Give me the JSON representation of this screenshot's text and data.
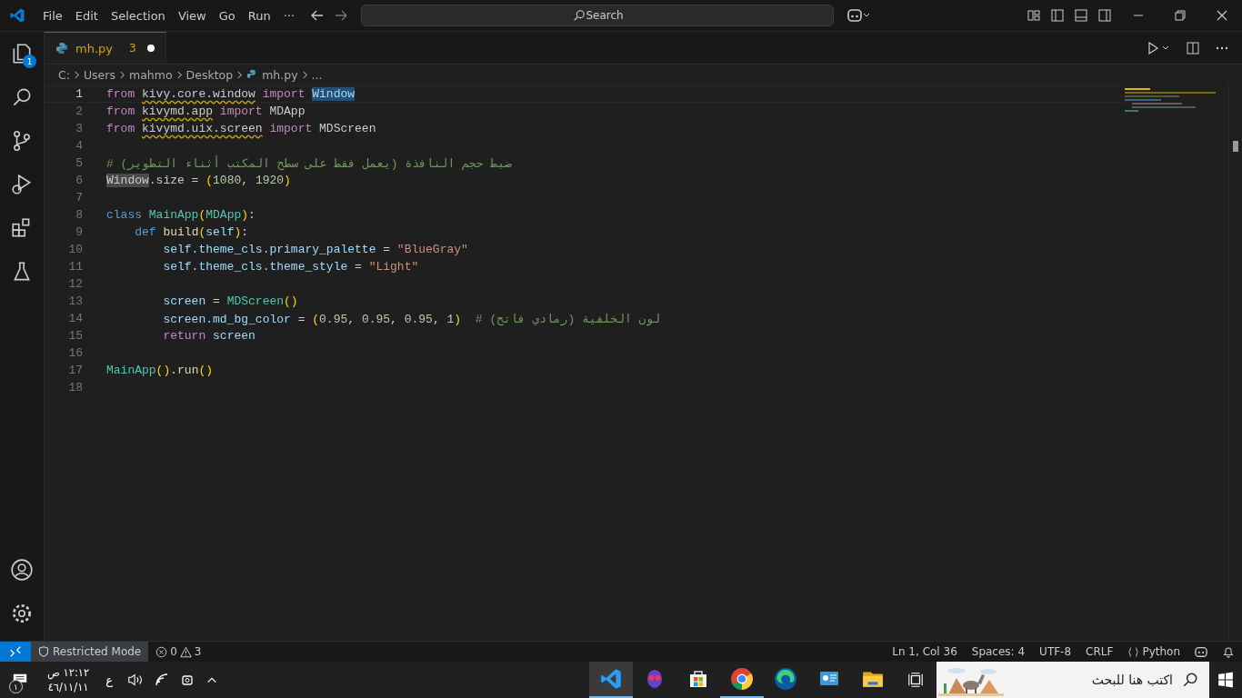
{
  "window": {
    "menu": [
      "File",
      "Edit",
      "Selection",
      "View",
      "Go",
      "Run",
      "···"
    ],
    "search": {
      "placeholder": "Search"
    }
  },
  "activity_bar": [
    {
      "kind": "explorer",
      "badge": "1"
    },
    {
      "kind": "search"
    },
    {
      "kind": "source-control"
    },
    {
      "kind": "run-debug"
    },
    {
      "kind": "extensions"
    },
    {
      "kind": "testing"
    }
  ],
  "tabs": [
    {
      "label": "mh.py",
      "problems": "3",
      "modified": true,
      "selected": true
    }
  ],
  "breadcrumbs": [
    {
      "kind": "folder",
      "text": "C:"
    },
    {
      "kind": "folder",
      "text": "Users"
    },
    {
      "kind": "folder",
      "text": "mahmo"
    },
    {
      "kind": "folder",
      "text": "Desktop"
    },
    {
      "kind": "python",
      "text": "mh.py"
    },
    {
      "kind": "symbol",
      "text": "..."
    }
  ],
  "editor": {
    "lines": [
      {
        "number": "1",
        "current": true,
        "tokens": [
          {
            "kind": "kw",
            "text": "from "
          },
          {
            "kind": "mod",
            "text": "kivy.core.window"
          },
          {
            "kind": "kw",
            "text": " import "
          },
          {
            "kind": "sel",
            "text": "Window"
          }
        ]
      },
      {
        "number": "2",
        "current": false,
        "tokens": [
          {
            "kind": "kw",
            "text": "from "
          },
          {
            "kind": "mod",
            "text": "kivymd.app"
          },
          {
            "kind": "kw",
            "text": " import "
          },
          {
            "kind": "plain",
            "text": "MDApp"
          }
        ]
      },
      {
        "number": "3",
        "current": false,
        "tokens": [
          {
            "kind": "kw",
            "text": "from "
          },
          {
            "kind": "mod",
            "text": "kivymd.uix.screen"
          },
          {
            "kind": "kw",
            "text": " import "
          },
          {
            "kind": "plain",
            "text": "MDScreen"
          }
        ]
      },
      {
        "number": "4",
        "current": false
      },
      {
        "number": "5",
        "current": false,
        "tokens": [
          {
            "kind": "comment",
            "text": "# ضبط حجم النافذة (يعمل فقط على سطح المكتب أثناء التطوير)"
          }
        ]
      },
      {
        "number": "6",
        "current": false,
        "tokens": [
          {
            "kind": "hl",
            "text": "Window"
          },
          {
            "kind": "plain",
            "text": ".size = "
          },
          {
            "kind": "paren",
            "text": "("
          },
          {
            "kind": "num",
            "text": "1080"
          },
          {
            "kind": "plain",
            "text": ", "
          },
          {
            "kind": "num",
            "text": "1920"
          },
          {
            "kind": "paren",
            "text": ")"
          }
        ]
      },
      {
        "number": "7",
        "current": false
      },
      {
        "number": "8",
        "current": false,
        "tokens": [
          {
            "kind": "def",
            "text": "class "
          },
          {
            "kind": "cls",
            "text": "MainApp"
          },
          {
            "kind": "paren",
            "text": "("
          },
          {
            "kind": "cls",
            "text": "MDApp"
          },
          {
            "kind": "paren",
            "text": ")"
          },
          {
            "kind": "plain",
            "text": ":"
          }
        ]
      },
      {
        "number": "9",
        "current": false,
        "tokens": [
          {
            "kind": "def",
            "text": "    def "
          },
          {
            "kind": "fn",
            "text": "build"
          },
          {
            "kind": "paren",
            "text": "("
          },
          {
            "kind": "var",
            "text": "self"
          },
          {
            "kind": "paren",
            "text": ")"
          },
          {
            "kind": "plain",
            "text": ":"
          }
        ]
      },
      {
        "number": "10",
        "current": false,
        "tokens": [
          {
            "kind": "var",
            "text": "        self.theme_cls.primary_palette"
          },
          {
            "kind": "plain",
            "text": " = "
          },
          {
            "kind": "str",
            "text": "\"BlueGray\""
          }
        ]
      },
      {
        "number": "11",
        "current": false,
        "tokens": [
          {
            "kind": "var",
            "text": "        self.theme_cls.theme_style"
          },
          {
            "kind": "plain",
            "text": " = "
          },
          {
            "kind": "str",
            "text": "\"Light\""
          }
        ]
      },
      {
        "number": "12",
        "current": false
      },
      {
        "number": "13",
        "current": false,
        "tokens": [
          {
            "kind": "var",
            "text": "        screen"
          },
          {
            "kind": "plain",
            "text": " = "
          },
          {
            "kind": "cls",
            "text": "MDScreen"
          },
          {
            "kind": "paren",
            "text": "()"
          }
        ]
      },
      {
        "number": "14",
        "current": false,
        "tokens": [
          {
            "kind": "var",
            "text": "        screen.md_bg_color"
          },
          {
            "kind": "plain",
            "text": " = "
          },
          {
            "kind": "paren",
            "text": "("
          },
          {
            "kind": "num",
            "text": "0.95"
          },
          {
            "kind": "plain",
            "text": ", "
          },
          {
            "kind": "num",
            "text": "0.95"
          },
          {
            "kind": "plain",
            "text": ", "
          },
          {
            "kind": "num",
            "text": "0.95"
          },
          {
            "kind": "plain",
            "text": ", "
          },
          {
            "kind": "num",
            "text": "1"
          },
          {
            "kind": "paren",
            "text": ")"
          },
          {
            "kind": "comment",
            "text": "  # لون الخلفية (رمادي فاتح)"
          }
        ]
      },
      {
        "number": "15",
        "current": false,
        "tokens": [
          {
            "kind": "kw",
            "text": "        return "
          },
          {
            "kind": "var",
            "text": "screen"
          }
        ]
      },
      {
        "number": "16",
        "current": false
      },
      {
        "number": "17",
        "current": false,
        "tokens": [
          {
            "kind": "cls",
            "text": "MainApp"
          },
          {
            "kind": "paren",
            "text": "()"
          },
          {
            "kind": "plain",
            "text": "."
          },
          {
            "kind": "fn",
            "text": "run"
          },
          {
            "kind": "paren",
            "text": "()"
          }
        ]
      },
      {
        "number": "18",
        "current": false
      }
    ]
  },
  "status_bar": {
    "restricted": "Restricted Mode",
    "errors": "0",
    "warnings": "3",
    "right": [
      {
        "kind": "text",
        "text": "Ln 1, Col 36"
      },
      {
        "kind": "text",
        "text": "Spaces: 4"
      },
      {
        "kind": "text",
        "text": "UTF-8"
      },
      {
        "kind": "text",
        "text": "CRLF"
      },
      {
        "kind": "language",
        "text": "Python"
      }
    ]
  },
  "taskbar": {
    "notifications": "١",
    "time": "١٢:١٢ ص",
    "date": "٤٦/١١/١١",
    "language": "ع",
    "apps": [
      {
        "kind": "vscode",
        "selected": true,
        "running": true
      },
      {
        "kind": "mascot",
        "selected": false,
        "running": false
      },
      {
        "kind": "store",
        "selected": false,
        "running": false
      },
      {
        "kind": "chrome",
        "selected": false,
        "running": true
      },
      {
        "kind": "edge",
        "selected": false,
        "running": false
      },
      {
        "kind": "dashboard",
        "selected": false,
        "running": false
      },
      {
        "kind": "folder",
        "selected": false,
        "running": false
      }
    ],
    "search": {
      "placeholder": "اكتب هنا للبحث"
    }
  }
}
